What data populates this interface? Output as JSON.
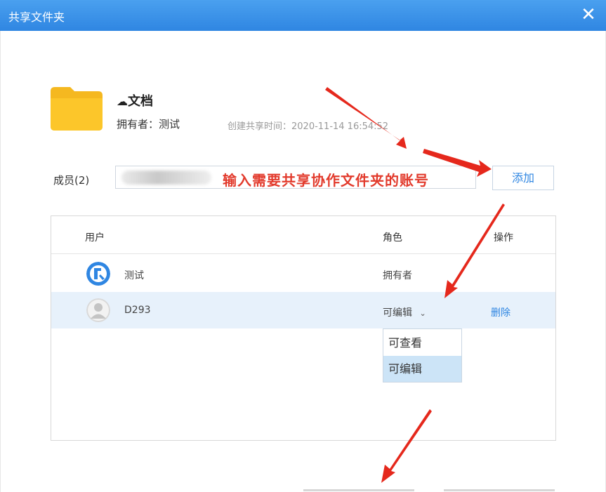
{
  "window": {
    "title": "共享文件夹",
    "close_label": "✕"
  },
  "folder": {
    "name": "文档",
    "owner_label": "拥有者：",
    "owner_value": "测试",
    "created_text": "创建共享时间：2020-11-14 16:54:52"
  },
  "members": {
    "label": "成员(2)",
    "input_hint": "输入需要共享协作文件夹的账号",
    "add_label": "添加"
  },
  "table": {
    "columns": {
      "user": "用户",
      "role": "角色",
      "action": "操作"
    },
    "rows": [
      {
        "name": "测试",
        "role": "拥有者",
        "action": ""
      },
      {
        "name": "D293",
        "role": "可编辑",
        "action": "删除"
      }
    ]
  },
  "role_dropdown": {
    "options": [
      "可查看",
      "可编辑"
    ],
    "selected": "可编辑"
  },
  "colors": {
    "titlebar": "#2f86e2",
    "accent": "#2f86e2",
    "hint": "#e23a2c",
    "selected_row": "#e7f1fb",
    "arrow": "#e5281c"
  }
}
